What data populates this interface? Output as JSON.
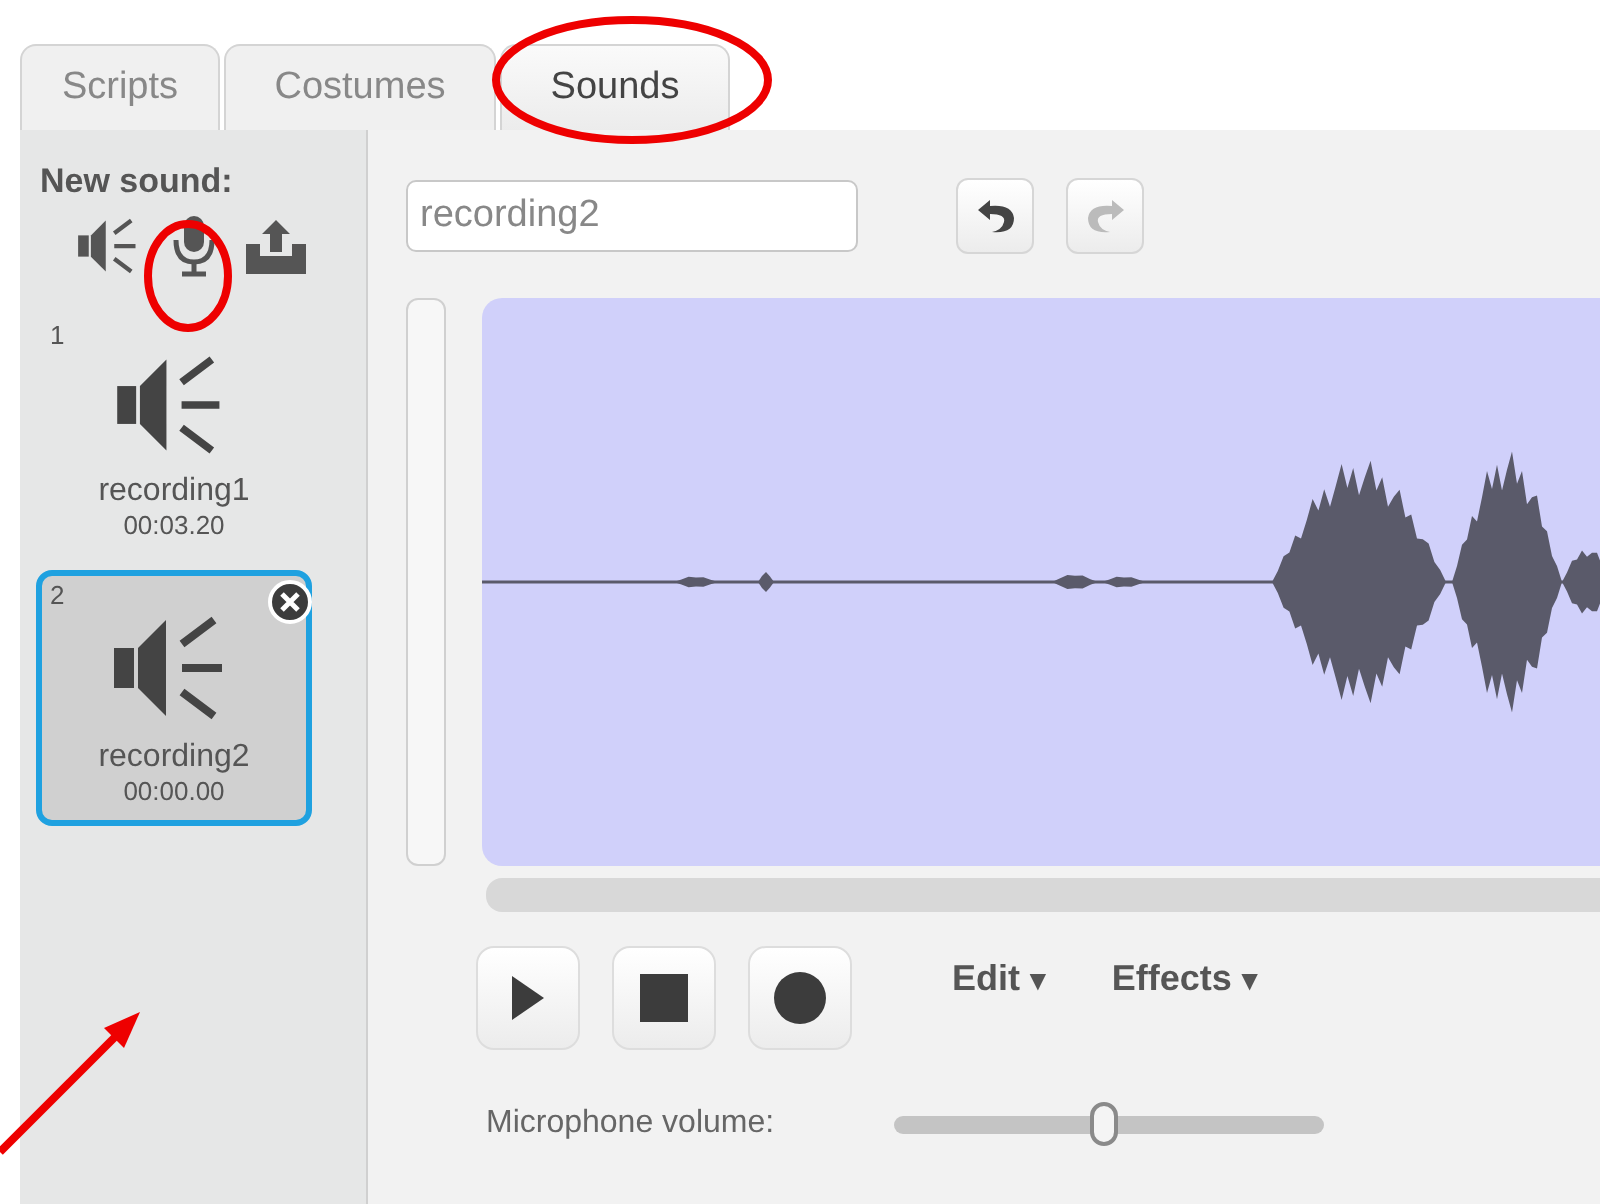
{
  "tabs": [
    {
      "label": "Scripts",
      "selected": false
    },
    {
      "label": "Costumes",
      "selected": false
    },
    {
      "label": "Sounds",
      "selected": true
    }
  ],
  "new_sound": {
    "label": "New sound:"
  },
  "sounds": [
    {
      "number": "1",
      "name": "recording1",
      "duration": "00:03.20",
      "selected": false
    },
    {
      "number": "2",
      "name": "recording2",
      "duration": "00:00.00",
      "selected": true
    }
  ],
  "editor": {
    "name_value": "recording2",
    "undo_disabled": false,
    "redo_disabled": true,
    "menus": [
      {
        "label": "Edit",
        "caret": "▼"
      },
      {
        "label": "Effects",
        "caret": "▼"
      }
    ],
    "volume": {
      "label": "Microphone volume:",
      "level": 0.49
    }
  }
}
